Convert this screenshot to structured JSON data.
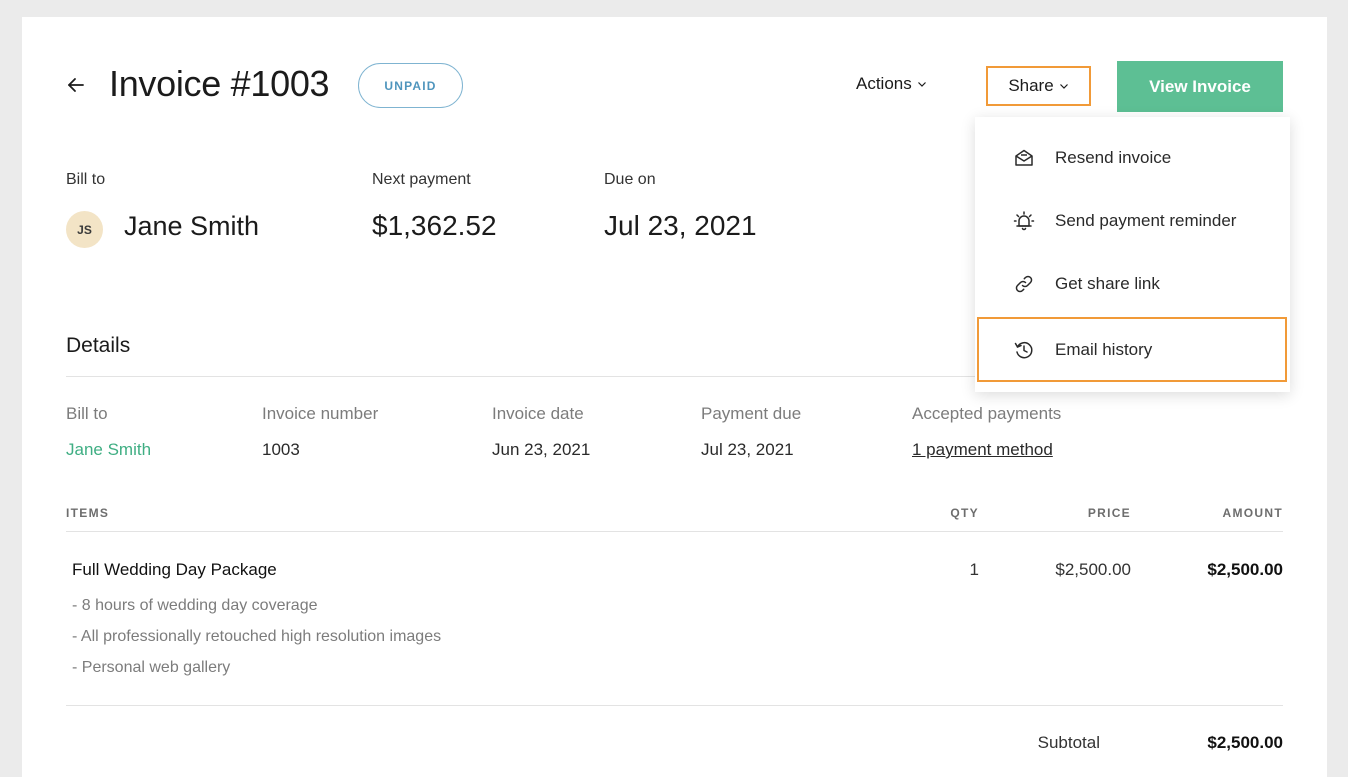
{
  "header": {
    "title": "Invoice #1003",
    "status_badge": "UNPAID",
    "actions_label": "Actions",
    "share_label": "Share",
    "view_invoice_label": "View Invoice"
  },
  "summary": {
    "bill_to_label": "Bill to",
    "client_initials": "JS",
    "client_name": "Jane Smith",
    "next_payment_label": "Next payment",
    "next_payment_value": "$1,362.52",
    "due_on_label": "Due on",
    "due_on_value": "Jul 23, 2021"
  },
  "details": {
    "title": "Details",
    "bill_to_label": "Bill to",
    "bill_to_value": "Jane Smith",
    "invoice_number_label": "Invoice number",
    "invoice_number_value": "1003",
    "invoice_date_label": "Invoice date",
    "invoice_date_value": "Jun 23, 2021",
    "payment_due_label": "Payment due",
    "payment_due_value": "Jul 23, 2021",
    "accepted_payments_label": "Accepted payments",
    "accepted_payments_value": "1 payment method"
  },
  "items_table": {
    "headers": {
      "items": "ITEMS",
      "qty": "QTY",
      "price": "PRICE",
      "amount": "AMOUNT"
    },
    "rows": [
      {
        "name": "Full Wedding Day Package",
        "lines": [
          "- 8 hours of wedding day coverage",
          "- All professionally retouched high resolution images",
          "- Personal web gallery"
        ],
        "qty": "1",
        "price": "$2,500.00",
        "amount": "$2,500.00"
      }
    ],
    "subtotal_label": "Subtotal",
    "subtotal_value": "$2,500.00"
  },
  "share_menu": {
    "items": [
      {
        "label": "Resend invoice",
        "icon": "envelope-open-icon"
      },
      {
        "label": "Send payment reminder",
        "icon": "bell-alert-icon"
      },
      {
        "label": "Get share link",
        "icon": "link-icon"
      },
      {
        "label": "Email history",
        "icon": "history-icon"
      }
    ],
    "highlighted_item": "Email history"
  },
  "colors": {
    "accent_green": "#5dbf94",
    "highlight_orange": "#f19a38",
    "badge_blue": "#4f95bd"
  }
}
